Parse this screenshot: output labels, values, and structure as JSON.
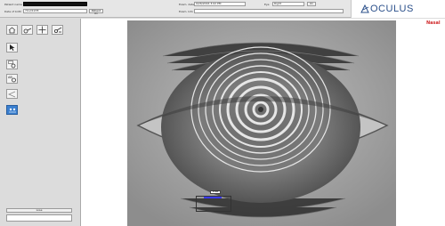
{
  "header": {
    "patient_name_label": "Patient name",
    "dob_label": "Date of birth",
    "dob_value": "7/12/1978",
    "patient_id_label": "Patient ID",
    "exam_date_label": "Exam. date",
    "exam_date_value": "9/26/2016  3:02 PM",
    "eye_label": "Eye",
    "eye_value": "Right",
    "extra_label": "ID",
    "exam_info_label": "Exam. Info"
  },
  "brand": {
    "logo_text": "OCULUS"
  },
  "viewer": {
    "orientation_label": "Nasal",
    "selection_label": "Lines"
  },
  "left_panel": {
    "bottom_button": "Lose"
  },
  "colors": {
    "brand": "#2a4f8a",
    "nasal": "#d0282a",
    "active_tool": "#3a7fd0"
  }
}
